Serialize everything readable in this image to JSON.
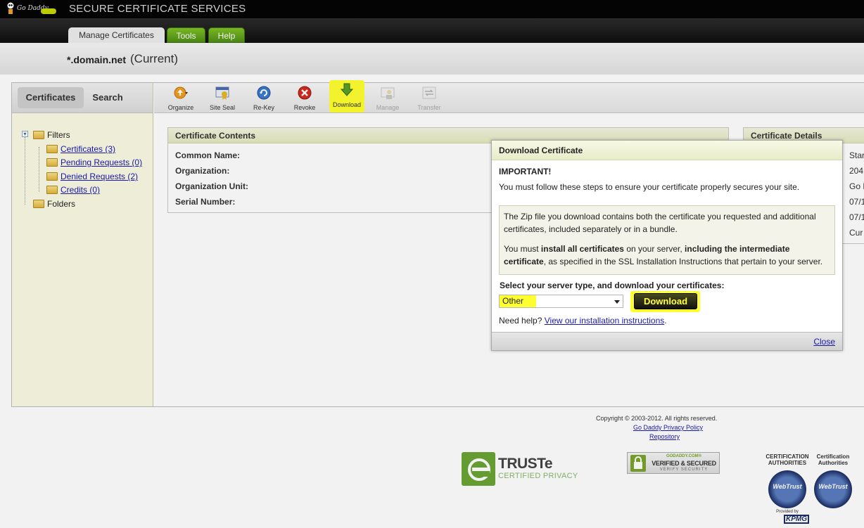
{
  "header": {
    "brand": "Go Daddy",
    "app_title": "SECURE CERTIFICATE SERVICES"
  },
  "nav_tabs": [
    {
      "label": "Manage Certificates"
    },
    {
      "label": "Tools"
    },
    {
      "label": "Help"
    }
  ],
  "subheader": {
    "domain": "*.domain.net",
    "status": "(Current)"
  },
  "left_panel": {
    "tabs": [
      "Certificates",
      "Search"
    ],
    "tree": {
      "filters_label": "Filters",
      "items": [
        {
          "label": "Certificates (3)"
        },
        {
          "label": "Pending Requests (0)"
        },
        {
          "label": "Denied Requests (2)"
        },
        {
          "label": "Credits (0)"
        }
      ],
      "folders_label": "Folders"
    }
  },
  "toolbar": {
    "items": [
      {
        "label": "Organize",
        "icon": "organize-icon"
      },
      {
        "label": "Site Seal",
        "icon": "site-seal-icon"
      },
      {
        "label": "Re-Key",
        "icon": "rekey-icon"
      },
      {
        "label": "Revoke",
        "icon": "revoke-icon"
      },
      {
        "label": "Download",
        "icon": "download-icon"
      },
      {
        "label": "Manage",
        "icon": "manage-icon"
      },
      {
        "label": "Transfer",
        "icon": "transfer-icon"
      }
    ]
  },
  "certificate_contents": {
    "title": "Certificate Contents",
    "fields": [
      "Common Name:",
      "Organization:",
      "Organization Unit:",
      "Serial Number:"
    ]
  },
  "certificate_details": {
    "title": "Certificate Details",
    "values": [
      "Star",
      "204",
      "Go D",
      "07/1",
      "07/1",
      "Cur"
    ]
  },
  "modal": {
    "title": "Download Certificate",
    "important": "IMPORTANT!",
    "steps_text": "You must follow these steps to ensure your certificate properly secures your site.",
    "info_p1": "The Zip file you download contains both the certificate you requested and additional certificates, included separately or in a bundle.",
    "info_p2_a": "You must ",
    "info_p2_b": "install all certificates",
    "info_p2_c": " on your server, ",
    "info_p2_d": "including the intermediate certificate",
    "info_p2_e": ", as specified in the SSL Installation Instructions that pertain to your server.",
    "select_label": "Select your server type, and download your certificates:",
    "server_type_value": "Other",
    "download_button": "Download",
    "help_prefix": "Need help?",
    "help_link": "View our installation instructions",
    "help_suffix": ".",
    "close_link": "Close"
  },
  "footer": {
    "copyright": "Copyright © 2003-2012. All rights reserved.",
    "privacy_link": "Go Daddy Privacy Policy",
    "repository_link": "Repository",
    "truste_main": "TRUSTe",
    "truste_sub": "CERTIFIED PRIVACY",
    "verified_top": "GODADDY.COM®",
    "verified_mid": "VERIFIED & SECURED",
    "verified_bot": "VERIFY SECURITY",
    "webtrust_1_head": "CERTIFICATION AUTHORITIES",
    "webtrust_2_head": "Certification Authorities",
    "webtrust_name": "WebTrust",
    "provided_by": "Provided by",
    "kpmg": "KPMG"
  },
  "colors": {
    "highlight": "#ffff30",
    "green_tab": "#6aa72a",
    "panel_bg": "#fbfbe4"
  }
}
